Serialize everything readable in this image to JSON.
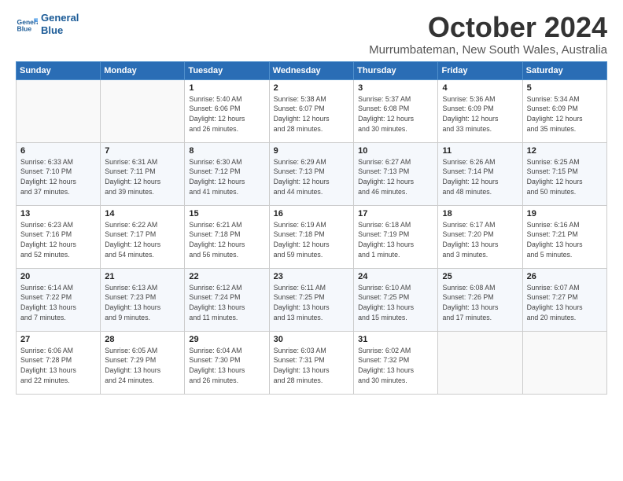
{
  "header": {
    "logo_line1": "General",
    "logo_line2": "Blue",
    "month": "October 2024",
    "location": "Murrumbateman, New South Wales, Australia"
  },
  "days_of_week": [
    "Sunday",
    "Monday",
    "Tuesday",
    "Wednesday",
    "Thursday",
    "Friday",
    "Saturday"
  ],
  "weeks": [
    [
      {
        "day": "",
        "info": ""
      },
      {
        "day": "",
        "info": ""
      },
      {
        "day": "1",
        "info": "Sunrise: 5:40 AM\nSunset: 6:06 PM\nDaylight: 12 hours\nand 26 minutes."
      },
      {
        "day": "2",
        "info": "Sunrise: 5:38 AM\nSunset: 6:07 PM\nDaylight: 12 hours\nand 28 minutes."
      },
      {
        "day": "3",
        "info": "Sunrise: 5:37 AM\nSunset: 6:08 PM\nDaylight: 12 hours\nand 30 minutes."
      },
      {
        "day": "4",
        "info": "Sunrise: 5:36 AM\nSunset: 6:09 PM\nDaylight: 12 hours\nand 33 minutes."
      },
      {
        "day": "5",
        "info": "Sunrise: 5:34 AM\nSunset: 6:09 PM\nDaylight: 12 hours\nand 35 minutes."
      }
    ],
    [
      {
        "day": "6",
        "info": "Sunrise: 6:33 AM\nSunset: 7:10 PM\nDaylight: 12 hours\nand 37 minutes."
      },
      {
        "day": "7",
        "info": "Sunrise: 6:31 AM\nSunset: 7:11 PM\nDaylight: 12 hours\nand 39 minutes."
      },
      {
        "day": "8",
        "info": "Sunrise: 6:30 AM\nSunset: 7:12 PM\nDaylight: 12 hours\nand 41 minutes."
      },
      {
        "day": "9",
        "info": "Sunrise: 6:29 AM\nSunset: 7:13 PM\nDaylight: 12 hours\nand 44 minutes."
      },
      {
        "day": "10",
        "info": "Sunrise: 6:27 AM\nSunset: 7:13 PM\nDaylight: 12 hours\nand 46 minutes."
      },
      {
        "day": "11",
        "info": "Sunrise: 6:26 AM\nSunset: 7:14 PM\nDaylight: 12 hours\nand 48 minutes."
      },
      {
        "day": "12",
        "info": "Sunrise: 6:25 AM\nSunset: 7:15 PM\nDaylight: 12 hours\nand 50 minutes."
      }
    ],
    [
      {
        "day": "13",
        "info": "Sunrise: 6:23 AM\nSunset: 7:16 PM\nDaylight: 12 hours\nand 52 minutes."
      },
      {
        "day": "14",
        "info": "Sunrise: 6:22 AM\nSunset: 7:17 PM\nDaylight: 12 hours\nand 54 minutes."
      },
      {
        "day": "15",
        "info": "Sunrise: 6:21 AM\nSunset: 7:18 PM\nDaylight: 12 hours\nand 56 minutes."
      },
      {
        "day": "16",
        "info": "Sunrise: 6:19 AM\nSunset: 7:18 PM\nDaylight: 12 hours\nand 59 minutes."
      },
      {
        "day": "17",
        "info": "Sunrise: 6:18 AM\nSunset: 7:19 PM\nDaylight: 13 hours\nand 1 minute."
      },
      {
        "day": "18",
        "info": "Sunrise: 6:17 AM\nSunset: 7:20 PM\nDaylight: 13 hours\nand 3 minutes."
      },
      {
        "day": "19",
        "info": "Sunrise: 6:16 AM\nSunset: 7:21 PM\nDaylight: 13 hours\nand 5 minutes."
      }
    ],
    [
      {
        "day": "20",
        "info": "Sunrise: 6:14 AM\nSunset: 7:22 PM\nDaylight: 13 hours\nand 7 minutes."
      },
      {
        "day": "21",
        "info": "Sunrise: 6:13 AM\nSunset: 7:23 PM\nDaylight: 13 hours\nand 9 minutes."
      },
      {
        "day": "22",
        "info": "Sunrise: 6:12 AM\nSunset: 7:24 PM\nDaylight: 13 hours\nand 11 minutes."
      },
      {
        "day": "23",
        "info": "Sunrise: 6:11 AM\nSunset: 7:25 PM\nDaylight: 13 hours\nand 13 minutes."
      },
      {
        "day": "24",
        "info": "Sunrise: 6:10 AM\nSunset: 7:25 PM\nDaylight: 13 hours\nand 15 minutes."
      },
      {
        "day": "25",
        "info": "Sunrise: 6:08 AM\nSunset: 7:26 PM\nDaylight: 13 hours\nand 17 minutes."
      },
      {
        "day": "26",
        "info": "Sunrise: 6:07 AM\nSunset: 7:27 PM\nDaylight: 13 hours\nand 20 minutes."
      }
    ],
    [
      {
        "day": "27",
        "info": "Sunrise: 6:06 AM\nSunset: 7:28 PM\nDaylight: 13 hours\nand 22 minutes."
      },
      {
        "day": "28",
        "info": "Sunrise: 6:05 AM\nSunset: 7:29 PM\nDaylight: 13 hours\nand 24 minutes."
      },
      {
        "day": "29",
        "info": "Sunrise: 6:04 AM\nSunset: 7:30 PM\nDaylight: 13 hours\nand 26 minutes."
      },
      {
        "day": "30",
        "info": "Sunrise: 6:03 AM\nSunset: 7:31 PM\nDaylight: 13 hours\nand 28 minutes."
      },
      {
        "day": "31",
        "info": "Sunrise: 6:02 AM\nSunset: 7:32 PM\nDaylight: 13 hours\nand 30 minutes."
      },
      {
        "day": "",
        "info": ""
      },
      {
        "day": "",
        "info": ""
      }
    ]
  ]
}
